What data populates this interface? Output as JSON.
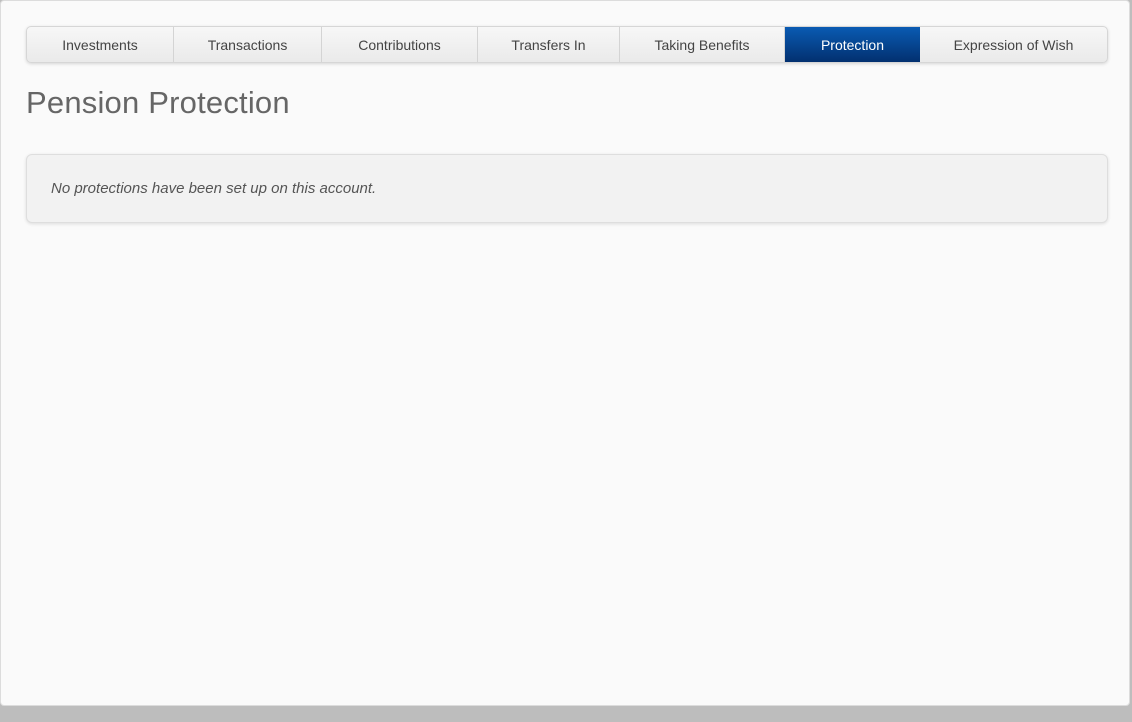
{
  "tabs": [
    {
      "label": "Investments",
      "active": false
    },
    {
      "label": "Transactions",
      "active": false
    },
    {
      "label": "Contributions",
      "active": false
    },
    {
      "label": "Transfers In",
      "active": false
    },
    {
      "label": "Taking Benefits",
      "active": false
    },
    {
      "label": "Protection",
      "active": true
    },
    {
      "label": "Expression of Wish",
      "active": false
    }
  ],
  "page": {
    "title": "Pension Protection",
    "notice": "No protections have been set up on this account."
  },
  "colors": {
    "active_tab": "#02306f",
    "active_tab_text": "#ffffff",
    "title": "#666666"
  }
}
